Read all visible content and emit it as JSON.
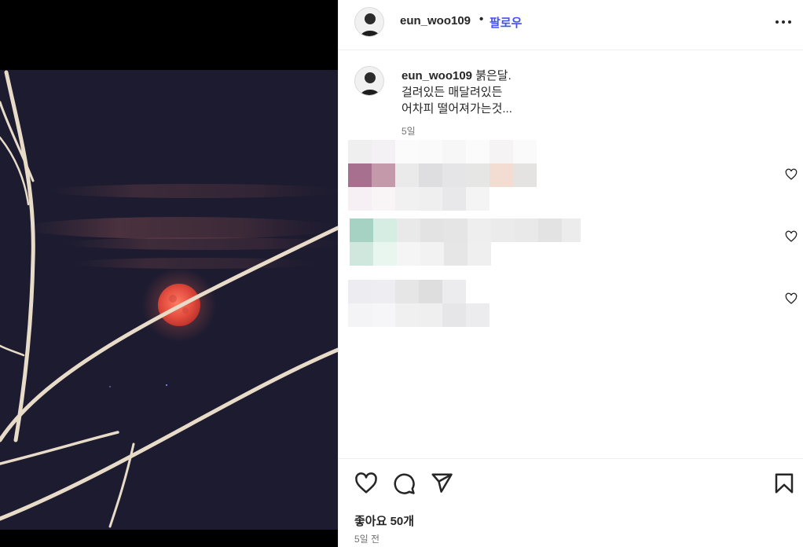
{
  "post": {
    "username": "eun_woo109",
    "separator": "•",
    "follow_label": "팔로우",
    "caption_line1": " 붉은달.",
    "caption_line2": "걸려있든 매달려있든",
    "caption_line3": "어차피 떨어져가는것...",
    "caption_time": "5일",
    "likes": "좋아요 50개",
    "posted_time": "5일 전"
  },
  "icons": {
    "more": "more-options-icon",
    "like": "heart-icon",
    "comment": "comment-icon",
    "share": "send-icon",
    "save": "bookmark-icon",
    "comment_like": "heart-outline-icon"
  },
  "colors": {
    "follow": "#4150f7",
    "moon": "#e9564a",
    "sky": "#1c1b30"
  }
}
